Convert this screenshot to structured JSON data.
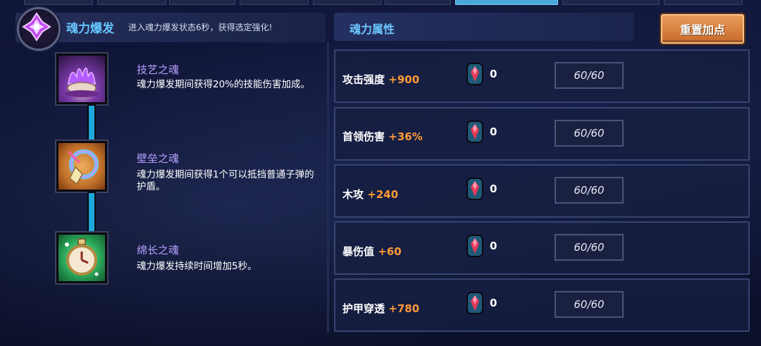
{
  "burst": {
    "title": "魂力爆发",
    "description": "进入魂力爆发状态6秒，获得选定强化!",
    "icon": "purple-crystal-icon"
  },
  "attributes_panel": {
    "title": "魂力属性",
    "reset_label": "重置加点"
  },
  "souls": [
    {
      "name": "技艺之魂",
      "description": "魂力爆发期间获得20%的技能伤害加成。",
      "icon": "purple-flame-lotus-icon"
    },
    {
      "name": "壁垒之魂",
      "description": "魂力爆发期间获得1个可以抵挡普通子弹的护盾。",
      "icon": "shield-ring-icon"
    },
    {
      "name": "绵长之魂",
      "description": "魂力爆发持续时间增加5秒。",
      "icon": "pocket-watch-icon"
    }
  ],
  "attributes": [
    {
      "label": "攻击强度",
      "bonus": "+900",
      "gems": "0",
      "max": "60/60"
    },
    {
      "label": "首领伤害",
      "bonus": "+36%",
      "gems": "0",
      "max": "60/60"
    },
    {
      "label": "木攻",
      "bonus": "+240",
      "gems": "0",
      "max": "60/60"
    },
    {
      "label": "暴伤值",
      "bonus": "+60",
      "gems": "0",
      "max": "60/60"
    },
    {
      "label": "护甲穿透",
      "bonus": "+780",
      "gems": "0",
      "max": "60/60"
    }
  ],
  "colors": {
    "accent_blue": "#67c6ff",
    "bonus_orange": "#ff9a38",
    "soul_name_purple": "#b7a0ff",
    "reset_button": "#d87a3a"
  }
}
